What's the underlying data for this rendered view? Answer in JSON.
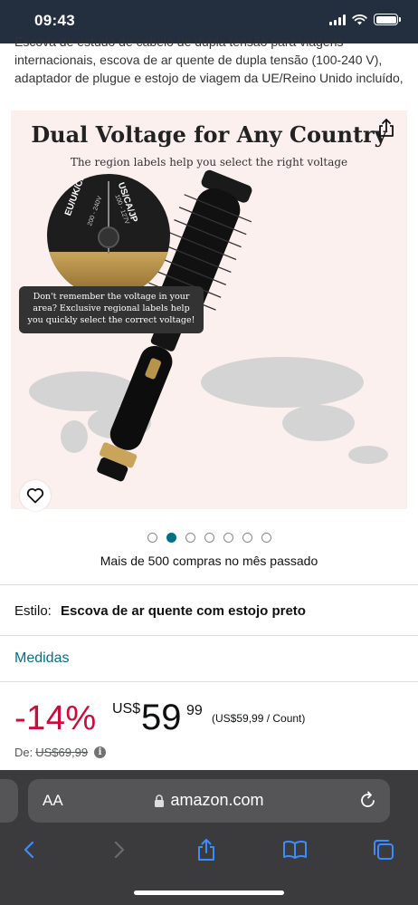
{
  "status_bar": {
    "time": "09:43"
  },
  "description": "Escova de estudo de cabelo de dupla tensão para viagens internacionais, escova de ar quente de dupla tensão (100-240 V), adaptador de plugue e estojo de viagem da UE/Reino Unido incluído,",
  "product_image": {
    "title": "Dual Voltage for Any Country",
    "subtitle": "The region labels help you select the right voltage",
    "callout": "Don't remember the voltage in your area? Exclusive regional labels help you quickly select the correct voltage!",
    "label_left": "EU/UK/CN",
    "label_left_voltage": "200 - 240V",
    "label_right": "US/CA/JP",
    "label_right_voltage": "100 - 127V"
  },
  "carousel": {
    "count": 7,
    "active_index": 1
  },
  "purchases_text": "Mais de 500 compras no mês passado",
  "style": {
    "label": "Estilo:",
    "value": "Escova de ar quente com estojo preto"
  },
  "medidas_label": "Medidas",
  "price": {
    "discount": "-14%",
    "currency": "US$",
    "whole": "59",
    "cents": "99",
    "unit_price": "(US$59,99 / Count)",
    "list_label": "De:",
    "list_price": "US$69,99"
  },
  "browser": {
    "aa_label": "AA",
    "url": "amazon.com"
  },
  "colors": {
    "status_bar_bg": "#232F3E",
    "discount": "#CC0C39",
    "link": "#007185",
    "browser_chrome": "#3b3b3d"
  }
}
